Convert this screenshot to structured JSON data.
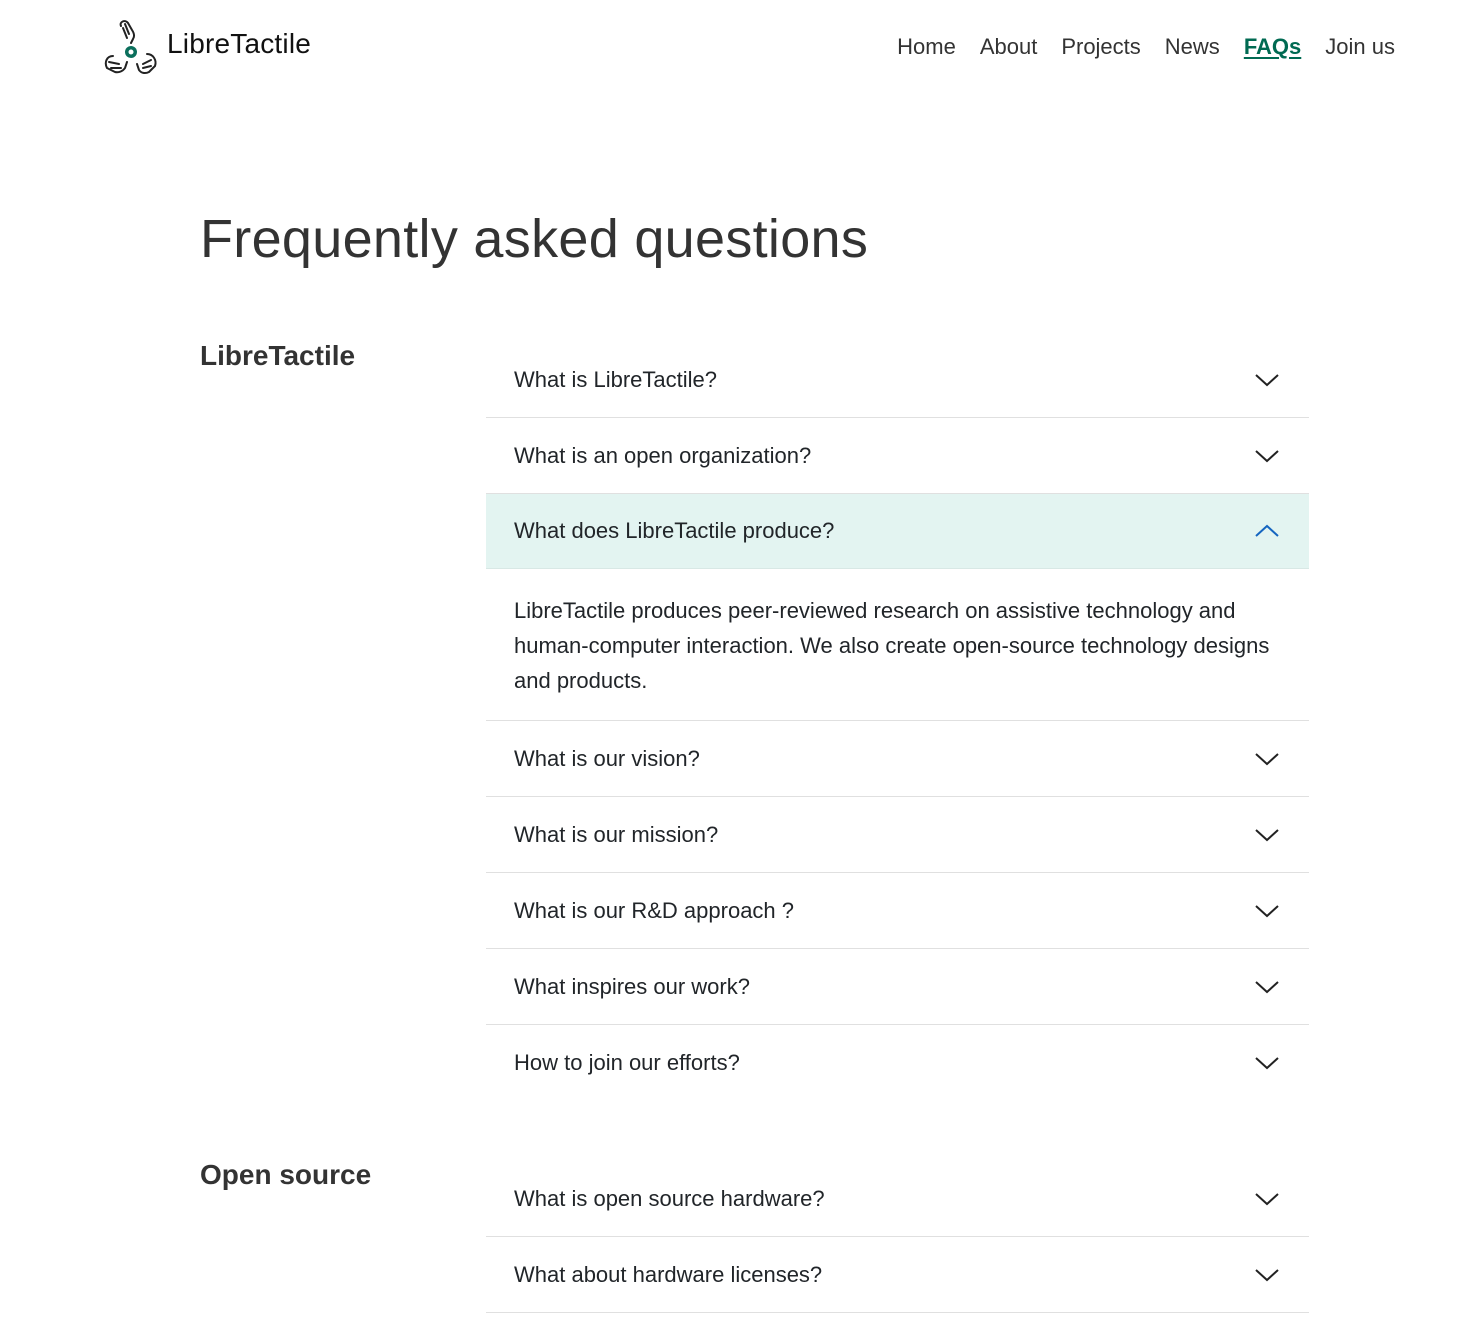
{
  "brand": {
    "name": "LibreTactile"
  },
  "nav": {
    "items": [
      {
        "label": "Home"
      },
      {
        "label": "About"
      },
      {
        "label": "Projects"
      },
      {
        "label": "News"
      },
      {
        "label": "FAQs",
        "active": true
      },
      {
        "label": "Join us"
      }
    ]
  },
  "page": {
    "title": "Frequently asked questions"
  },
  "sections": [
    {
      "title": "LibreTactile",
      "items": [
        {
          "question": "What is LibreTactile?"
        },
        {
          "question": "What is an open organization?"
        },
        {
          "question": "What does LibreTactile produce?",
          "open": true,
          "answer": "LibreTactile produces peer-reviewed research on assistive technology and human-computer interaction. We also create open-source technology designs and products."
        },
        {
          "question": "What is our vision?"
        },
        {
          "question": "What is our mission?"
        },
        {
          "question": "What is our R&D approach ?"
        },
        {
          "question": "What inspires our work?"
        },
        {
          "question": "How to join our efforts?"
        }
      ]
    },
    {
      "title": "Open source",
      "items": [
        {
          "question": "What is open source hardware?"
        },
        {
          "question": "What about hardware licenses?"
        }
      ]
    }
  ],
  "colors": {
    "accent": "#006a52",
    "open_bg": "#e3f4f1",
    "chevron_open": "#1565c0"
  }
}
